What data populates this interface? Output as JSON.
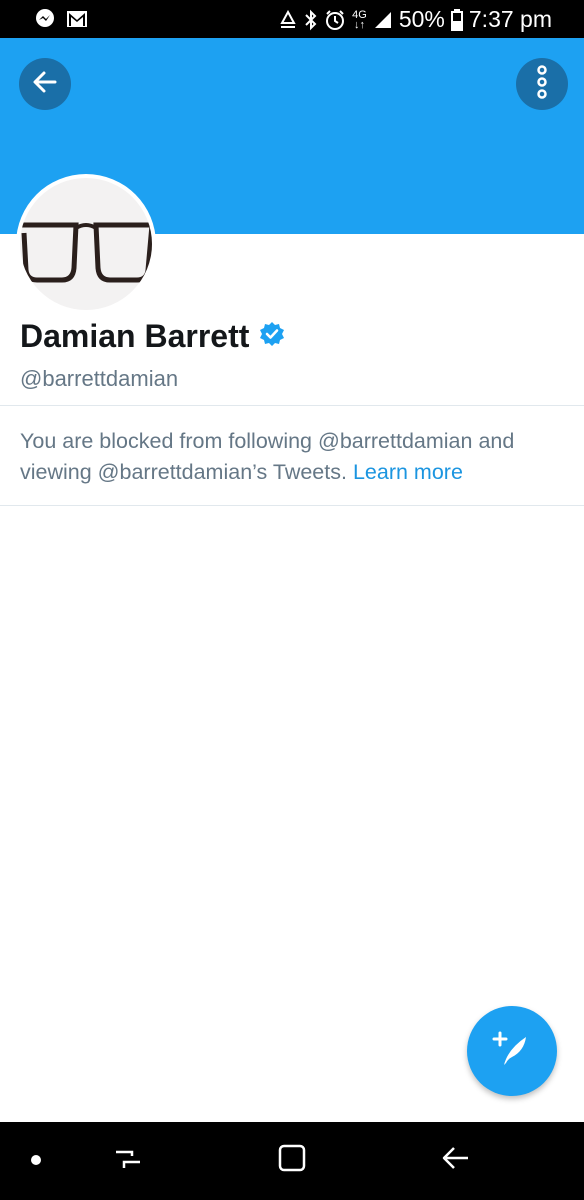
{
  "status_bar": {
    "battery": "50%",
    "time": "7:37 pm",
    "network": "4G",
    "icons": [
      "messenger-icon",
      "gmail-icon",
      "recycle-icon",
      "bluetooth-icon",
      "alarm-icon",
      "4g-icon",
      "signal-icon",
      "battery-icon"
    ]
  },
  "profile": {
    "name": "Damian Barrett",
    "verified": true,
    "handle": "@barrettdamian"
  },
  "blocked_notice": {
    "text": "You are blocked from following @barrettdamian and viewing @barrettdamian’s Tweets.",
    "link": "Learn more"
  },
  "colors": {
    "header": "#1da1f2",
    "header_button": "#1a6fa8",
    "link": "#1b95e0",
    "text_secondary": "#657786"
  },
  "icons": {
    "back": "arrow-left-icon",
    "more": "more-vertical-icon",
    "compose": "compose-tweet-icon",
    "nav": [
      "dot-icon",
      "recent-apps-icon",
      "home-icon",
      "back-icon"
    ]
  }
}
